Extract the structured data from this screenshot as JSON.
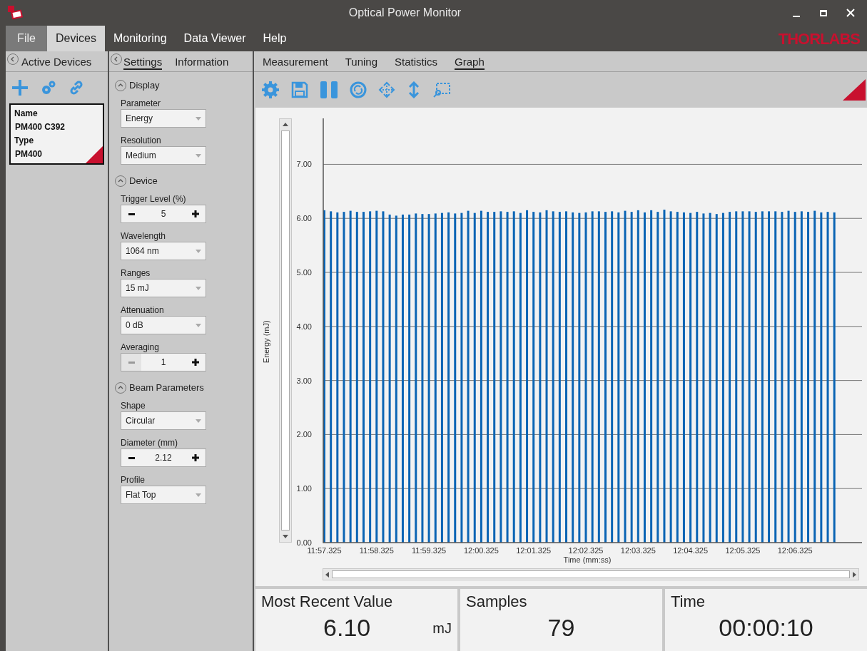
{
  "window": {
    "title": "Optical Power Monitor"
  },
  "menu": [
    {
      "label": "File",
      "selected": false,
      "hovered": true
    },
    {
      "label": "Devices",
      "selected": true,
      "hovered": false
    },
    {
      "label": "Monitoring",
      "selected": false,
      "hovered": false
    },
    {
      "label": "Data Viewer",
      "selected": false,
      "hovered": false
    },
    {
      "label": "Help",
      "selected": false,
      "hovered": false
    }
  ],
  "brand": "THORLABS",
  "devices_panel": {
    "title": "Active Devices",
    "devices": [
      {
        "fields": [
          {
            "label": "Name",
            "value": "PM400 C392"
          },
          {
            "label": "Type",
            "value": "PM400"
          }
        ],
        "selected": true
      }
    ]
  },
  "settings_panel": {
    "tabs": [
      {
        "label": "Settings",
        "selected": true
      },
      {
        "label": "Information",
        "selected": false
      }
    ],
    "sections": [
      {
        "title": "Display",
        "expanded": true,
        "fields": [
          {
            "kind": "dropdown",
            "label": "Parameter",
            "value": "Energy"
          },
          {
            "kind": "dropdown",
            "label": "Resolution",
            "value": "Medium"
          }
        ]
      },
      {
        "title": "Device",
        "expanded": true,
        "fields": [
          {
            "kind": "stepper",
            "label": "Trigger Level (%)",
            "value": "5",
            "minus_disabled": false
          },
          {
            "kind": "dropdown",
            "label": "Wavelength",
            "value": "1064 nm"
          },
          {
            "kind": "dropdown",
            "label": "Ranges",
            "value": "15 mJ"
          },
          {
            "kind": "dropdown",
            "label": "Attenuation",
            "value": "0 dB"
          },
          {
            "kind": "stepper",
            "label": "Averaging",
            "value": "1",
            "minus_disabled": true
          }
        ]
      },
      {
        "title": "Beam Parameters",
        "expanded": true,
        "fields": [
          {
            "kind": "dropdown",
            "label": "Shape",
            "value": "Circular"
          },
          {
            "kind": "stepper",
            "label": "Diameter (mm)",
            "value": "2.12",
            "minus_disabled": false
          },
          {
            "kind": "dropdown",
            "label": "Profile",
            "value": "Flat Top"
          }
        ]
      }
    ]
  },
  "main_tabs": [
    {
      "label": "Measurement",
      "selected": false
    },
    {
      "label": "Tuning",
      "selected": false
    },
    {
      "label": "Statistics",
      "selected": false
    },
    {
      "label": "Graph",
      "selected": true
    }
  ],
  "graph": {
    "chart_data": {
      "type": "bar",
      "grid": true,
      "xlabel": "Time (mm:ss)",
      "ylabel": "Energy (mJ)",
      "ylim": [
        0,
        7.85
      ],
      "categories": [
        "11:57.325",
        null,
        null,
        null,
        null,
        null,
        null,
        null,
        "11:58.325",
        null,
        null,
        null,
        null,
        null,
        null,
        null,
        "11:59.325",
        null,
        null,
        null,
        null,
        null,
        null,
        null,
        "12:00.325",
        null,
        null,
        null,
        null,
        null,
        null,
        null,
        "12:01.325",
        null,
        null,
        null,
        null,
        null,
        null,
        null,
        "12:02.325",
        null,
        null,
        null,
        null,
        null,
        null,
        null,
        "12:03.325",
        null,
        null,
        null,
        null,
        null,
        null,
        null,
        "12:04.325",
        null,
        null,
        null,
        null,
        null,
        null,
        null,
        "12:05.325",
        null,
        null,
        null,
        null,
        null,
        null,
        null,
        "12:06.325",
        null,
        null,
        null,
        null,
        null,
        null
      ],
      "yticks": [
        {
          "value": 0,
          "label": "0.00"
        },
        {
          "value": 1,
          "label": "1.00"
        },
        {
          "value": 2,
          "label": "2.00"
        },
        {
          "value": 3,
          "label": "3.00"
        },
        {
          "value": 4,
          "label": "4.00"
        },
        {
          "value": 5,
          "label": "5.00"
        },
        {
          "value": 6,
          "label": "6.00"
        },
        {
          "value": 7,
          "label": "7.00"
        }
      ],
      "series": [
        {
          "color": "#0a64b4",
          "values": [
            6.15,
            6.13,
            6.11,
            6.12,
            6.14,
            6.12,
            6.12,
            6.13,
            6.14,
            6.13,
            6.07,
            6.05,
            6.07,
            6.07,
            6.09,
            6.08,
            6.08,
            6.09,
            6.1,
            6.11,
            6.09,
            6.1,
            6.14,
            6.1,
            6.14,
            6.12,
            6.12,
            6.13,
            6.12,
            6.13,
            6.1,
            6.15,
            6.12,
            6.11,
            6.15,
            6.13,
            6.12,
            6.13,
            6.11,
            6.1,
            6.11,
            6.13,
            6.13,
            6.12,
            6.13,
            6.11,
            6.14,
            6.12,
            6.15,
            6.11,
            6.15,
            6.12,
            6.16,
            6.13,
            6.12,
            6.11,
            6.1,
            6.12,
            6.09,
            6.1,
            6.08,
            6.1,
            6.12,
            6.13,
            6.13,
            6.13,
            6.12,
            6.13,
            6.13,
            6.13,
            6.12,
            6.14,
            6.12,
            6.13,
            6.12,
            6.14,
            6.11,
            6.12,
            6.11
          ]
        }
      ]
    }
  },
  "stats": [
    {
      "title": "Most Recent Value",
      "value": "6.10",
      "unit": "mJ"
    },
    {
      "title": "Samples",
      "value": "79"
    },
    {
      "title": "Time",
      "value": "00:00:10"
    }
  ]
}
